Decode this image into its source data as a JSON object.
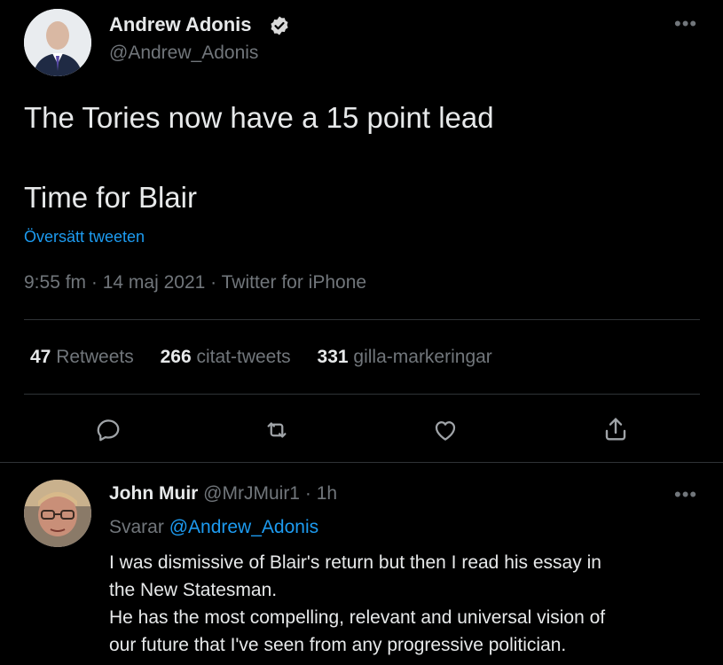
{
  "tweet": {
    "author_name": "Andrew Adonis",
    "author_handle": "@Andrew_Adonis",
    "text_line1": "The Tories now have a 15 point lead",
    "text_line2": "Time for Blair",
    "translate_label": "Översätt tweeten",
    "time": "9:55 fm",
    "date": "14 maj 2021",
    "source": "Twitter for iPhone",
    "sep": "·",
    "more_icon": "more-horizontal-icon",
    "verified_icon": "verified-badge-icon"
  },
  "stats": {
    "retweets_count": "47",
    "retweets_label": "Retweets",
    "quotes_count": "266",
    "quotes_label": "citat-tweets",
    "likes_count": "331",
    "likes_label": "gilla-markeringar"
  },
  "actions": [
    "reply-icon",
    "retweet-icon",
    "like-icon",
    "share-icon"
  ],
  "reply": {
    "author_name": "John Muir",
    "author_handle": "@MrJMuir1",
    "time": "1h",
    "sep": "·",
    "replying_label": "Svarar",
    "replying_to": "@Andrew_Adonis",
    "line1": "I was dismissive of Blair's return but then I read his essay in",
    "line2": "the New Statesman.",
    "line3": "He has the most compelling, relevant and universal vision of",
    "line4": "our future that I've seen from any progressive politician."
  },
  "colors": {
    "background": "#000000",
    "text": "#e7e9ea",
    "muted": "#71767b",
    "link": "#1d9bf0",
    "divider": "#2f3336"
  }
}
